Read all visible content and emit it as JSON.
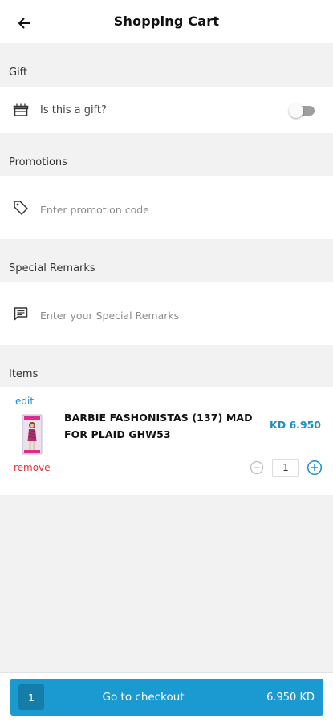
{
  "header": {
    "title": "Shopping Cart",
    "back_icon": "arrow-left-icon"
  },
  "gift": {
    "section_label": "Gift",
    "question": "Is this a gift?",
    "toggle_on": false,
    "icon": "gift-box-icon"
  },
  "promotions": {
    "section_label": "Promotions",
    "placeholder": "Enter promotion code",
    "value": "",
    "icon": "tag-icon"
  },
  "remarks": {
    "section_label": "Special Remarks",
    "placeholder": "Enter your Special Remarks",
    "value": "",
    "icon": "comment-icon"
  },
  "items": {
    "section_label": "Items",
    "list": [
      {
        "edit_label": "edit",
        "remove_label": "remove",
        "name": "BARBIE FASHONISTAS (137) MAD FOR PLAID GHW53",
        "price": "KD 6.950",
        "quantity": "1"
      }
    ]
  },
  "footer": {
    "count": "1",
    "checkout_label": "Go to checkout",
    "total": "6.950 KD"
  },
  "colors": {
    "accent": "#1a9ad0",
    "accent_dark": "#147ea9",
    "remove": "#e53935",
    "background": "#f2f2f2"
  }
}
